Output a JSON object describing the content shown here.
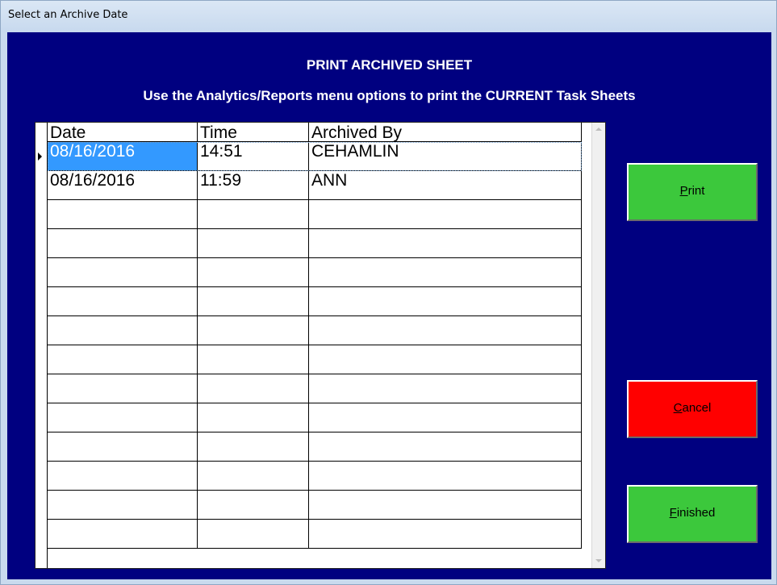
{
  "window": {
    "title": "Select an Archive Date"
  },
  "heading": {
    "line1": "PRINT ARCHIVED SHEET",
    "line2": "Use the Analytics/Reports menu options to print the CURRENT Task Sheets"
  },
  "table": {
    "columns": [
      "Date",
      "Time",
      "Archived By"
    ],
    "rows": [
      {
        "date": "08/16/2016",
        "time": "14:51",
        "by": "CEHAMLIN",
        "selected": true
      },
      {
        "date": "08/16/2016",
        "time": "11:59",
        "by": "ANN",
        "selected": false
      }
    ],
    "empty_rows": 12
  },
  "buttons": {
    "print": {
      "accel": "P",
      "rest": "rint"
    },
    "cancel": {
      "accel": "C",
      "rest": "ancel"
    },
    "finished": {
      "accel": "F",
      "rest": "inished"
    }
  },
  "colors": {
    "background": "#000080",
    "print": "#3cc83c",
    "cancel": "#ff0000",
    "finished": "#3cc83c",
    "selection": "#3399ff"
  }
}
